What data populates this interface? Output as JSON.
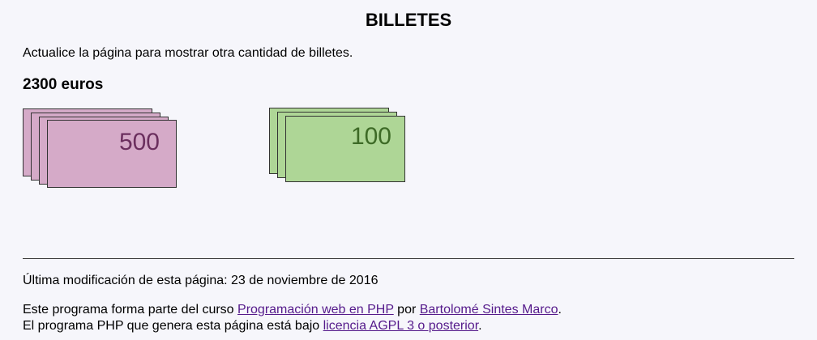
{
  "page": {
    "title": "BILLETES",
    "intro": "Actualice la página para mostrar otra cantidad de billetes.",
    "amount": "2300 euros"
  },
  "notes": [
    {
      "value": "500",
      "count": 4,
      "color": "#d5aac8"
    },
    {
      "value": "100",
      "count": 3,
      "color": "#aed696"
    }
  ],
  "footer": {
    "last_modified": "Última modificación de esta página: 23 de noviembre de 2016",
    "course_prefix": "Este programa forma parte del curso ",
    "course_link": "Programación web en PHP",
    "course_mid": " por ",
    "author_link": "Bartolomé Sintes Marco",
    "course_suffix": ".",
    "license_prefix": "El programa PHP que genera esta página está bajo ",
    "license_link": "licencia AGPL 3 o posterior",
    "license_suffix": "."
  }
}
